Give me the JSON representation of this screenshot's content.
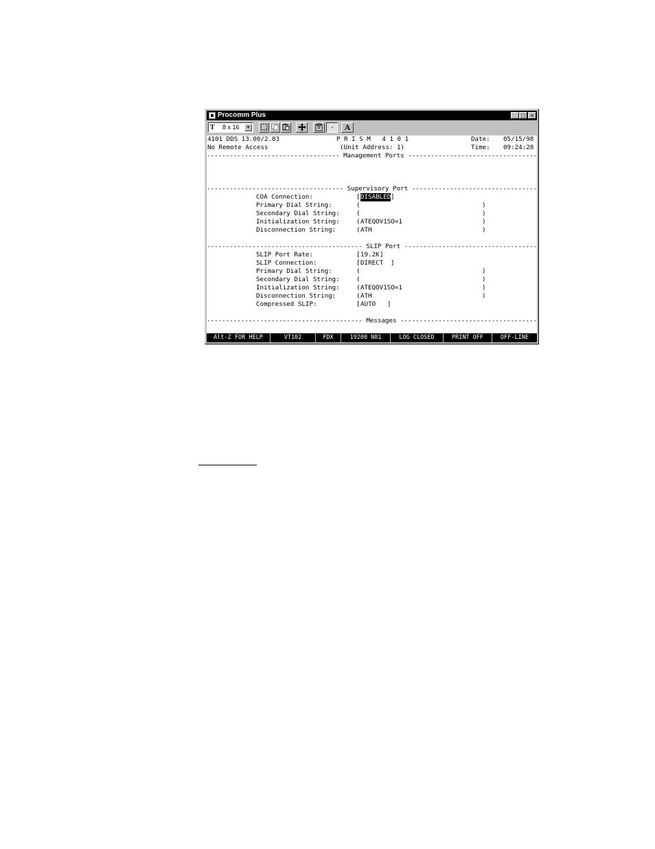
{
  "window": {
    "title": "Procomm Plus",
    "buttons": {
      "minimize": "_",
      "maximize": "□",
      "close": "×"
    }
  },
  "toolbar": {
    "font_icon": "T",
    "font_size": "8 x 16",
    "dropdown_arrow": "▾",
    "bold_text_label": "A",
    "icons": [
      "select-icon",
      "copy-icon",
      "paste-icon",
      "move-icon",
      "clipboard-icon",
      "toggle-icon",
      "text-style-icon"
    ]
  },
  "terminal": {
    "row1": {
      "left": "4101 DDS 13.00/2.03",
      "center": "P R I S M   4 1 0 1",
      "date_label": "Date:",
      "date_value": "05/15/98"
    },
    "row2": {
      "left": "No Remote Access",
      "center": "(Unit Address: 1)",
      "time_label": "Time:",
      "time_value": "09:24:28"
    },
    "management_sep": "----------------------------------- Management Ports -----------------------------------",
    "supervisory_sep": "------------------------------------ Supervisory Port ------------------------------------",
    "supervisory": [
      {
        "label": "COA Connection:",
        "open": "[",
        "value": "DISABLED",
        "close": "]",
        "highlight": true
      },
      {
        "label": "Primary Dial String:",
        "open": "(",
        "value": "",
        "close": ")",
        "highlight": false
      },
      {
        "label": "Secondary Dial String:",
        "open": "(",
        "value": "",
        "close": ")",
        "highlight": false
      },
      {
        "label": "Initialization String:",
        "open": "(",
        "value": "ATEQOV1SO=1",
        "close": ")",
        "highlight": false
      },
      {
        "label": "Disconnection String:",
        "open": "(",
        "value": "ATH",
        "close": ")",
        "highlight": false
      }
    ],
    "slip_sep": "----------------------------------------- SLIP Port -----------------------------------------",
    "slip": [
      {
        "label": "SLIP Port Rate:",
        "open": "[",
        "value": "19.2K",
        "close": "]",
        "highlight": false
      },
      {
        "label": "SLIP Connection:",
        "open": "[",
        "value": "DIRECT  ",
        "close": "]",
        "highlight": false
      },
      {
        "label": "Primary Dial String:",
        "open": "(",
        "value": "",
        "close": ")",
        "highlight": false
      },
      {
        "label": "Secondary Dial String:",
        "open": "(",
        "value": "",
        "close": ")",
        "highlight": false
      },
      {
        "label": "Initialization String:",
        "open": "(",
        "value": "ATEQOV1SO=1",
        "close": ")",
        "highlight": false
      },
      {
        "label": "Disconnection String:",
        "open": "(",
        "value": "ATH",
        "close": ")",
        "highlight": false
      },
      {
        "label": "Compressed SLIP:",
        "open": "[",
        "value": "AUTO   ",
        "close": "]",
        "highlight": false
      }
    ],
    "messages_sep": "----------------------------------------- Messages -----------------------------------------"
  },
  "statusbar": [
    "Alt-Z FOR HELP",
    "VT102",
    "FDX",
    "19200 N81",
    "LOG CLOSED",
    "PRINT OFF",
    "OFF-LINE"
  ]
}
